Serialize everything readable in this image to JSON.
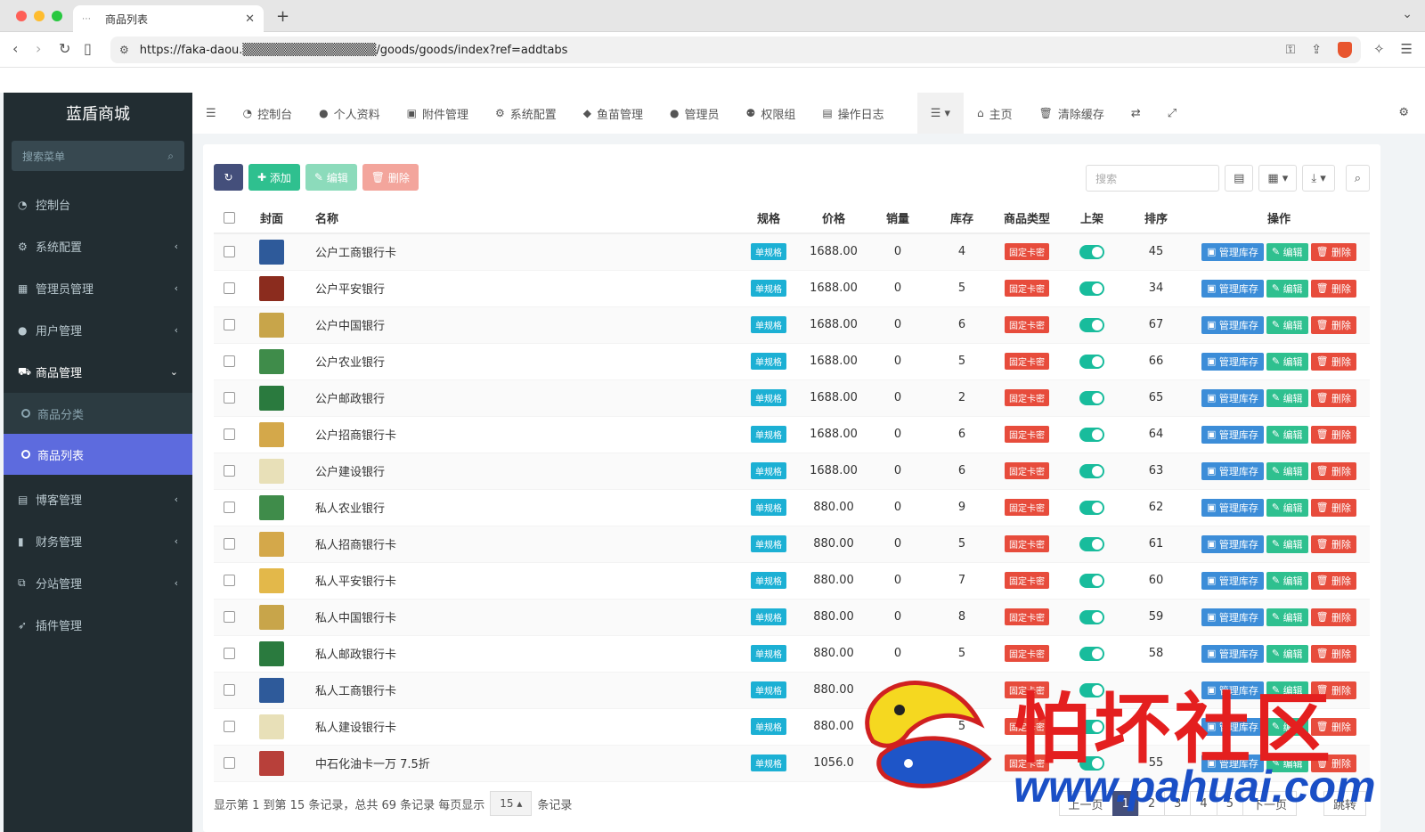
{
  "browser": {
    "tab_title": "商品列表",
    "url": "https://faka-daou.▒▒▒▒▒▒▒▒▒▒▒▒▒▒▒/goods/goods/index?ref=addtabs"
  },
  "sidebar": {
    "brand": "蓝盾商城",
    "search_placeholder": "搜索菜单",
    "items": [
      {
        "label": "控制台",
        "icon": "dashboard-icon"
      },
      {
        "label": "系统配置",
        "icon": "cogs-icon"
      },
      {
        "label": "管理员管理",
        "icon": "windows-icon"
      },
      {
        "label": "用户管理",
        "icon": "user-icon"
      },
      {
        "label": "商品管理",
        "icon": "cart-icon"
      },
      {
        "label": "博客管理",
        "icon": "book-icon"
      },
      {
        "label": "财务管理",
        "icon": "bookmark-icon"
      },
      {
        "label": "分站管理",
        "icon": "clone-icon"
      },
      {
        "label": "插件管理",
        "icon": "rocket-icon"
      }
    ],
    "sub_items": [
      {
        "label": "商品分类"
      },
      {
        "label": "商品列表"
      }
    ]
  },
  "topnav": {
    "items": [
      {
        "label": "控制台"
      },
      {
        "label": "个人资料"
      },
      {
        "label": "附件管理"
      },
      {
        "label": "系统配置"
      },
      {
        "label": "鱼苗管理"
      },
      {
        "label": "管理员"
      },
      {
        "label": "权限组"
      },
      {
        "label": "操作日志"
      }
    ],
    "home": "主页",
    "clear_cache": "清除缓存"
  },
  "toolbar": {
    "add": "添加",
    "edit": "编辑",
    "delete": "删除",
    "search_placeholder": "搜索"
  },
  "table": {
    "headers": [
      "封面",
      "名称",
      "规格",
      "价格",
      "销量",
      "库存",
      "商品类型",
      "上架",
      "排序",
      "操作"
    ],
    "spec_tag": "单规格",
    "type_tag": "固定卡密",
    "op_stock": "管理库存",
    "op_edit": "编辑",
    "op_delete": "删除",
    "rows": [
      {
        "name": "公户工商银行卡",
        "price": "1688.00",
        "sales": "0",
        "stock": "4",
        "sort": "45",
        "cover_color": "#2e5a9a"
      },
      {
        "name": "公户平安银行",
        "price": "1688.00",
        "sales": "0",
        "stock": "5",
        "sort": "34",
        "cover_color": "#8b2c1e"
      },
      {
        "name": "公户中国银行",
        "price": "1688.00",
        "sales": "0",
        "stock": "6",
        "sort": "67",
        "cover_color": "#c8a54a"
      },
      {
        "name": "公户农业银行",
        "price": "1688.00",
        "sales": "0",
        "stock": "5",
        "sort": "66",
        "cover_color": "#3f8c4a"
      },
      {
        "name": "公户邮政银行",
        "price": "1688.00",
        "sales": "0",
        "stock": "2",
        "sort": "65",
        "cover_color": "#2a7a3e"
      },
      {
        "name": "公户招商银行卡",
        "price": "1688.00",
        "sales": "0",
        "stock": "6",
        "sort": "64",
        "cover_color": "#d4a84a"
      },
      {
        "name": "公户建设银行",
        "price": "1688.00",
        "sales": "0",
        "stock": "6",
        "sort": "63",
        "cover_color": "#e8e0b8"
      },
      {
        "name": "私人农业银行",
        "price": "880.00",
        "sales": "0",
        "stock": "9",
        "sort": "62",
        "cover_color": "#3f8c4a"
      },
      {
        "name": "私人招商银行卡",
        "price": "880.00",
        "sales": "0",
        "stock": "5",
        "sort": "61",
        "cover_color": "#d4a84a"
      },
      {
        "name": "私人平安银行卡",
        "price": "880.00",
        "sales": "0",
        "stock": "7",
        "sort": "60",
        "cover_color": "#e3b84a"
      },
      {
        "name": "私人中国银行卡",
        "price": "880.00",
        "sales": "0",
        "stock": "8",
        "sort": "59",
        "cover_color": "#c8a54a"
      },
      {
        "name": "私人邮政银行卡",
        "price": "880.00",
        "sales": "0",
        "stock": "5",
        "sort": "58",
        "cover_color": "#2a7a3e"
      },
      {
        "name": "私人工商银行卡",
        "price": "880.00",
        "sales": "0",
        "stock": "",
        "sort": "",
        "cover_color": "#2e5a9a"
      },
      {
        "name": "私人建设银行卡",
        "price": "880.00",
        "sales": "",
        "stock": "5",
        "sort": "",
        "cover_color": "#e8e0b8"
      },
      {
        "name": "中石化油卡一万 7.5折",
        "price": "1056.0",
        "sales": "",
        "stock": "8",
        "sort": "55",
        "cover_color": "#b8403a"
      }
    ]
  },
  "footer": {
    "info_prefix": "显示第 1 到第 15 条记录，总共 69 条记录 每页显示",
    "page_size": "15",
    "info_suffix": "条记录",
    "prev": "上一页",
    "pages": [
      "1",
      "2",
      "3",
      "4",
      "5"
    ],
    "next": "下一页",
    "jump": "跳转"
  },
  "watermark": {
    "text": "怕坏社区",
    "url": "www.pahuai.com"
  }
}
